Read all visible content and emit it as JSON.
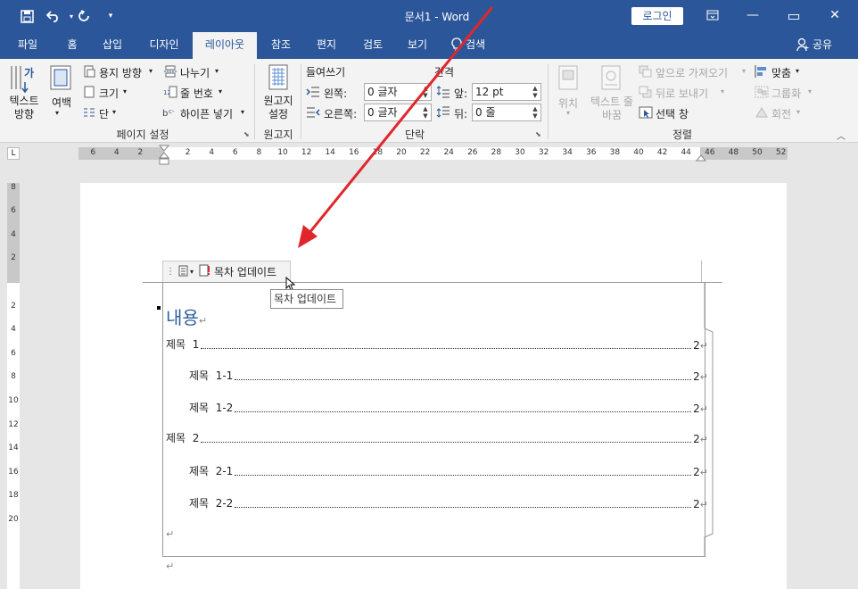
{
  "window": {
    "title": "문서1  -  Word",
    "login_label": "로그인",
    "share_label": "공유",
    "minimize": "—",
    "restore": "▭",
    "close": "✕"
  },
  "qat": {
    "save_icon": "save-icon",
    "undo_icon": "undo-icon",
    "redo_icon": "redo-icon",
    "customize_icon": "customize-icon"
  },
  "tabs": [
    {
      "label": "파일",
      "active": false
    },
    {
      "label": "홈",
      "active": false
    },
    {
      "label": "삽입",
      "active": false
    },
    {
      "label": "디자인",
      "active": false
    },
    {
      "label": "레이아웃",
      "active": true
    },
    {
      "label": "참조",
      "active": false
    },
    {
      "label": "편지",
      "active": false
    },
    {
      "label": "검토",
      "active": false
    },
    {
      "label": "보기",
      "active": false
    },
    {
      "label": "검색",
      "active": false
    }
  ],
  "ribbon": {
    "page_setup": {
      "text_direction": "텍스트 방향",
      "margins": "여백",
      "orientation": "용지 방향",
      "size": "크기",
      "columns": "단",
      "breaks": "나누기",
      "line_numbers": "줄 번호",
      "hyphenation": "하이픈 넣기",
      "group_label": "페이지 설정"
    },
    "manuscript": {
      "button": "원고지 설정",
      "group_label": "원고지"
    },
    "paragraph": {
      "indent_label": "들여쓰기",
      "spacing_label": "간격",
      "left_label": "왼쪽:",
      "right_label": "오른쪽:",
      "left_value": "0 글자",
      "right_value": "0 글자",
      "before_label": "앞:",
      "after_label": "뒤:",
      "before_value": "12 pt",
      "after_value": "0 줄",
      "group_label": "단락"
    },
    "arrange": {
      "position": "위치",
      "wrap_text": "텍스트 줄 바꿈",
      "bring_forward": "앞으로 가져오기",
      "send_backward": "뒤로 보내기",
      "selection_pane": "선택 창",
      "align": "맞춤",
      "group": "그룹화",
      "rotate": "회전",
      "group_label": "정렬"
    }
  },
  "ruler": {
    "h_ticks": [
      "6",
      "4",
      "2",
      "2",
      "4",
      "6",
      "8",
      "10",
      "12",
      "14",
      "16",
      "18",
      "20",
      "22",
      "24",
      "26",
      "28",
      "30",
      "32",
      "34",
      "36",
      "38",
      "40",
      "42",
      "44",
      "46",
      "48",
      "50",
      "52"
    ],
    "v_ticks": [
      "8",
      "6",
      "4",
      "2",
      "2",
      "4",
      "6",
      "8",
      "10",
      "12",
      "14",
      "16",
      "18",
      "20"
    ],
    "tab_selector": "L"
  },
  "document": {
    "cc_toolbar_label": "목차 업데이트",
    "tooltip": "목차 업데이트",
    "toc_heading": "내용",
    "toc_entries": [
      {
        "text": "제목  1",
        "page": "2",
        "level": 1
      },
      {
        "text": "제목  1-1",
        "page": "2",
        "level": 2
      },
      {
        "text": "제목  1-2",
        "page": "2",
        "level": 2
      },
      {
        "text": "제목  2",
        "page": "2",
        "level": 1
      },
      {
        "text": "제목  2-1",
        "page": "2",
        "level": 2
      },
      {
        "text": "제목  2-2",
        "page": "2",
        "level": 2
      }
    ],
    "para_mark": "↵"
  },
  "colors": {
    "accent": "#2b579a",
    "heading": "#2e5f9a",
    "arrow": "#e0262b"
  }
}
